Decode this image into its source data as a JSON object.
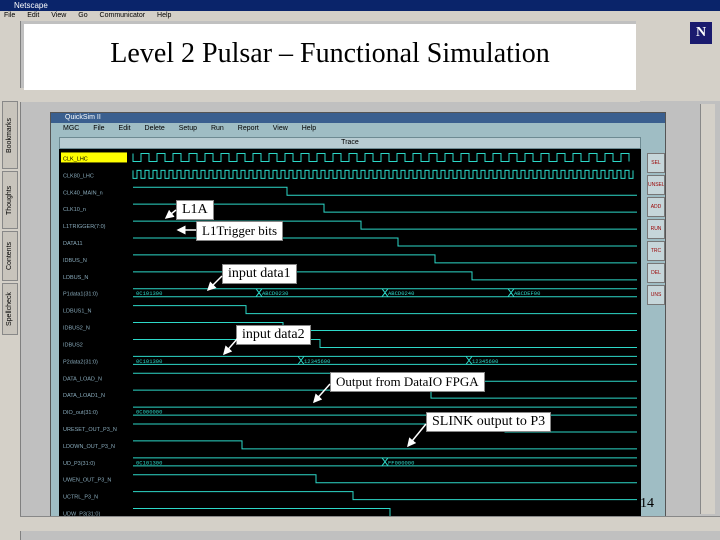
{
  "browser": {
    "title": "Netscape",
    "menu": [
      "File",
      "Edit",
      "View",
      "Go",
      "Communicator",
      "Help"
    ],
    "side_tabs": [
      "Bookmarks",
      "Thoughts",
      "Contents",
      "Spellcheck"
    ],
    "logo_letter": "N"
  },
  "slide": {
    "title": "Level 2 Pulsar – Functional Simulation",
    "page_number": "14"
  },
  "quicksim": {
    "window_title": "QuickSim II",
    "menu": [
      "MGC",
      "File",
      "Edit",
      "Delete",
      "Setup",
      "Run",
      "Report",
      "View",
      "Help"
    ],
    "trace_title": "Trace",
    "side_buttons": [
      "SEL",
      "UNSEL",
      "ADD",
      "RUN",
      "TRC",
      "DEL",
      "UNS"
    ]
  },
  "signals": [
    {
      "name": "CLK_LHC",
      "highlight": true
    },
    {
      "name": "CLK80_LHC"
    },
    {
      "name": "CLK40_MAIN_n"
    },
    {
      "name": "CLK10_n"
    },
    {
      "name": "L1TRIGGER(7:0)"
    },
    {
      "name": "DATA11"
    },
    {
      "name": "IDBUS_N"
    },
    {
      "name": "LDBUS_N"
    },
    {
      "name": "P1data1(31:0)",
      "values": [
        "0C101300",
        "ABCD0230",
        "ABCD0240",
        "ABCDEF00"
      ]
    },
    {
      "name": "LDBUS1_N"
    },
    {
      "name": "IDBUS2_N"
    },
    {
      "name": "IDBUS2"
    },
    {
      "name": "P2data2(31:0)",
      "values": [
        "0C101300",
        "12345600",
        "12345600"
      ]
    },
    {
      "name": "DATA_LOAD_N"
    },
    {
      "name": "DATA_LOAD1_N"
    },
    {
      "name": "DIO_out(31:0)",
      "values": [
        "0C000000"
      ]
    },
    {
      "name": "URESET_OUT_P3_N"
    },
    {
      "name": "LDOWN_OUT_P3_N"
    },
    {
      "name": "UD_P3(31:0)",
      "values": [
        "0C101300",
        "FF000000"
      ]
    },
    {
      "name": "UWEN_OUT_P3_N"
    },
    {
      "name": "UCTRL_P3_N"
    },
    {
      "name": "UDW_P3(31:0)"
    }
  ],
  "annotations": {
    "l1a": "L1A",
    "l1trigger": "L1Trigger bits",
    "input1": "input data1",
    "input2": "input data2",
    "output_dataio": "Output from DataIO FPGA",
    "slink": "SLINK output to P3"
  },
  "colors": {
    "wave": "#2dd8c8",
    "background": "#000000",
    "annotation_border": "#888888"
  }
}
